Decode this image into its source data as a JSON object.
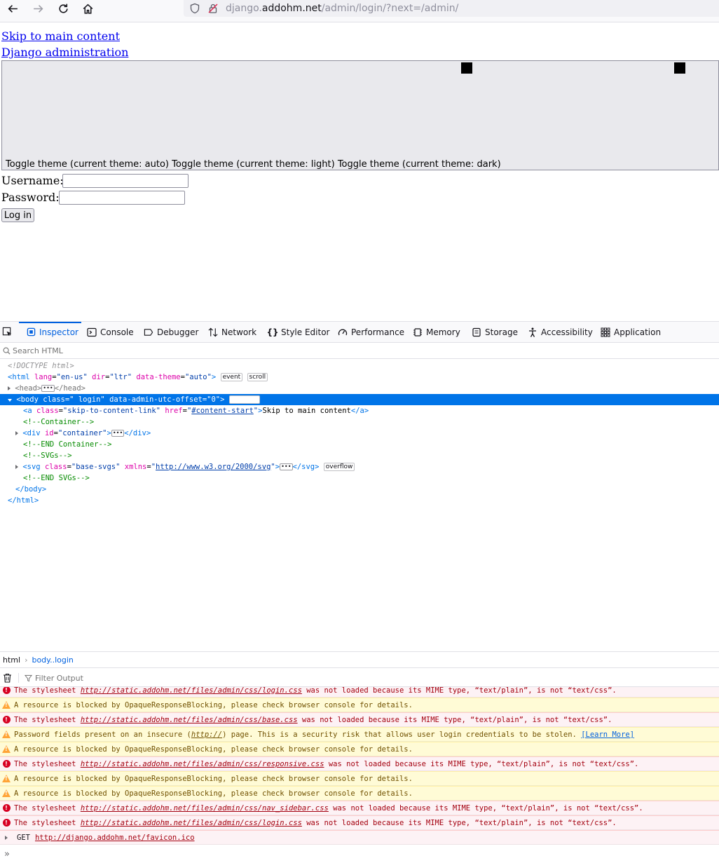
{
  "browser": {
    "url_prefix": "django.",
    "url_host": "addohm.net",
    "url_path": "/admin/login/?next=/admin/"
  },
  "page": {
    "skip_link": "Skip to main content",
    "site_title": "Django administration",
    "theme_toggle_text": "Toggle theme (current theme: auto) Toggle theme (current theme: light) Toggle theme (current theme: dark)",
    "username_label": "Username:",
    "password_label": "Password:",
    "login_button": "Log in",
    "username_value": "",
    "password_value": ""
  },
  "devtools": {
    "tabs": [
      {
        "label": "Inspector",
        "icon": "inspector-icon",
        "active": true
      },
      {
        "label": "Console",
        "icon": "console-icon"
      },
      {
        "label": "Debugger",
        "icon": "debugger-icon"
      },
      {
        "label": "Network",
        "icon": "network-icon"
      },
      {
        "label": "Style Editor",
        "icon": "style-editor-icon"
      },
      {
        "label": "Performance",
        "icon": "performance-icon"
      },
      {
        "label": "Memory",
        "icon": "memory-icon"
      },
      {
        "label": "Storage",
        "icon": "storage-icon"
      },
      {
        "label": "Accessibility",
        "icon": "accessibility-icon"
      },
      {
        "label": "Application",
        "icon": "application-icon"
      }
    ],
    "search_placeholder": "Search HTML",
    "markup": {
      "doctype": "<!DOCTYPE html>",
      "html_open": "<html",
      "html_attrs": [
        [
          "lang",
          "en-us"
        ],
        [
          "dir",
          "ltr"
        ],
        [
          "data-theme",
          "auto"
        ]
      ],
      "html_badges": [
        "event",
        "scroll"
      ],
      "head_open": "<head>",
      "head_close": "</head>",
      "body_line": "<body class=\" login\" data-admin-utc-offset=\"0\">",
      "body_badge": "overflow",
      "a_tag": "<a",
      "a_class_attr": "class",
      "a_class_val": "\"skip-to-content-link\"",
      "a_href_attr": "href",
      "a_href_val": "#content-start",
      "a_text": "Skip to main content",
      "a_close": "</a>",
      "comment_container": "<!--Container-->",
      "div_open": "<div",
      "div_attr": "id",
      "div_val": "\"container\"",
      "div_close": "</div>",
      "comment_end_container": "<!--END Container-->",
      "comment_svgs": "<!--SVGs-->",
      "svg_open": "<svg",
      "svg_class_attr": "class",
      "svg_class_val": "\"base-svgs\"",
      "svg_xmlns_attr": "xmlns",
      "svg_xmlns_val": "http://www.w3.org/2000/svg",
      "svg_close": "</svg>",
      "svg_badge": "overflow",
      "comment_end_svgs": "<!--END SVGs-->",
      "body_close": "</body>",
      "html_close": "</html>"
    },
    "breadcrumbs": [
      "html",
      "body..login"
    ],
    "filter_placeholder": "Filter Output",
    "console": [
      {
        "type": "err",
        "pre": "The stylesheet ",
        "link": "http://static.addohm.net/files/admin/css/login.css",
        "post": " was not loaded because its MIME type, “text/plain”, is not “text/css”."
      },
      {
        "type": "warn",
        "pre": "A resource is blocked by OpaqueResponseBlocking, please check browser console for details."
      },
      {
        "type": "err",
        "pre": "The stylesheet ",
        "link": "http://static.addohm.net/files/admin/css/base.css",
        "post": " was not loaded because its MIME type, “text/plain”, is not “text/css”."
      },
      {
        "type": "warn",
        "pre": "Password fields present on an insecure (",
        "link": "http://",
        "post": ") page. This is a security risk that allows user login credentials to be stolen. ",
        "learn": "[Learn More]"
      },
      {
        "type": "warn",
        "pre": "A resource is blocked by OpaqueResponseBlocking, please check browser console for details."
      },
      {
        "type": "err",
        "pre": "The stylesheet ",
        "link": "http://static.addohm.net/files/admin/css/responsive.css",
        "post": " was not loaded because its MIME type, “text/plain”, is not “text/css”."
      },
      {
        "type": "warn",
        "pre": "A resource is blocked by OpaqueResponseBlocking, please check browser console for details."
      },
      {
        "type": "warn",
        "pre": "A resource is blocked by OpaqueResponseBlocking, please check browser console for details."
      },
      {
        "type": "err",
        "pre": "The stylesheet ",
        "link": "http://static.addohm.net/files/admin/css/nav_sidebar.css",
        "post": " was not loaded because its MIME type, “text/plain”, is not “text/css”."
      },
      {
        "type": "err",
        "pre": "The stylesheet ",
        "link": "http://static.addohm.net/files/admin/css/login.css",
        "post": " was not loaded because its MIME type, “text/plain”, is not “text/css”."
      }
    ],
    "get_label": "GET",
    "get_url": "http://django.addohm.net/favicon.ico",
    "prompt": "»"
  },
  "colors": {
    "accent": "#0060df",
    "selection": "#0074e8",
    "error_bg": "#fdf2f5",
    "warn_bg": "#fffbd6"
  }
}
